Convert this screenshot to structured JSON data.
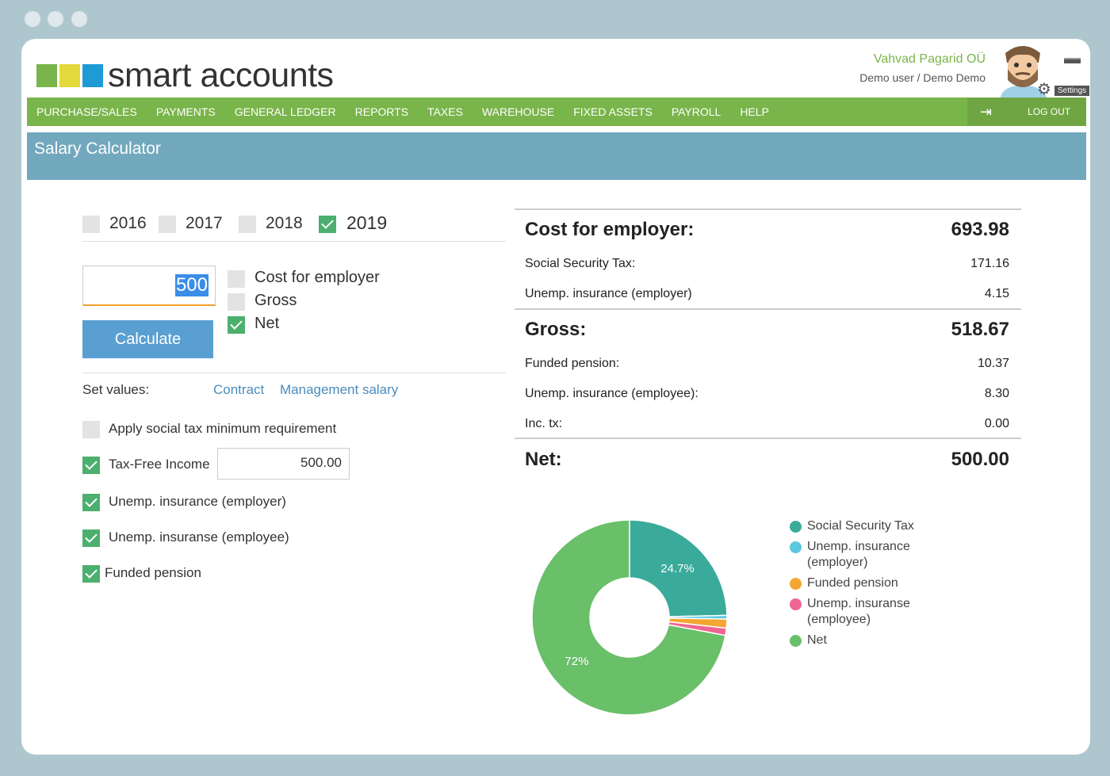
{
  "app": {
    "logo_text": "smart accounts",
    "logo_colors": [
      "#79b54a",
      "#e3d93a",
      "#1e9ad6"
    ],
    "company": "Vahvad Pagarid OÜ",
    "user": "Demo user / Demo Demo",
    "settings_label": "Settings"
  },
  "nav": {
    "items": [
      "PURCHASE/SALES",
      "PAYMENTS",
      "GENERAL LEDGER",
      "REPORTS",
      "TAXES",
      "WAREHOUSE",
      "FIXED ASSETS",
      "PAYROLL",
      "HELP"
    ],
    "logout": "LOG OUT"
  },
  "page": {
    "title": "Salary Calculator"
  },
  "years": [
    {
      "label": "2016",
      "checked": false
    },
    {
      "label": "2017",
      "checked": false
    },
    {
      "label": "2018",
      "checked": false
    },
    {
      "label": "2019",
      "checked": true
    }
  ],
  "calc": {
    "amount": "500",
    "button": "Calculate",
    "modes": [
      {
        "label": "Cost for employer",
        "checked": false
      },
      {
        "label": "Gross",
        "checked": false
      },
      {
        "label": "Net",
        "checked": true
      }
    ]
  },
  "set_values": {
    "label": "Set values:",
    "links": [
      "Contract",
      "Management salary"
    ]
  },
  "options": {
    "social_min": {
      "label": "Apply social tax minimum requirement",
      "checked": false
    },
    "tax_free": {
      "label": "Tax-Free Income",
      "checked": true,
      "value": "500.00"
    },
    "unemp_employer": {
      "label": "Unemp. insurance (employer)",
      "checked": true
    },
    "unemp_employee": {
      "label": "Unemp. insuranse (employee)",
      "checked": true
    },
    "funded_pension": {
      "label": "Funded pension",
      "checked": true
    }
  },
  "results": {
    "cost": {
      "label": "Cost for employer:",
      "value": "693.98"
    },
    "social_tax": {
      "label": "Social Security Tax:",
      "value": "171.16"
    },
    "unemp_employer": {
      "label": "Unemp. insurance (employer)",
      "value": "4.15"
    },
    "gross": {
      "label": "Gross:",
      "value": "518.67"
    },
    "funded_pension": {
      "label": "Funded pension:",
      "value": "10.37"
    },
    "unemp_employee": {
      "label": "Unemp. insurance (employee):",
      "value": "8.30"
    },
    "inc_tax": {
      "label": "Inc. tx:",
      "value": "0.00"
    },
    "net": {
      "label": "Net:",
      "value": "500.00"
    }
  },
  "chart_data": {
    "type": "pie",
    "categories": [
      "Social Security Tax",
      "Unemp. insurance (employer)",
      "Funded pension",
      "Unemp. insuranse (employee)",
      "Net"
    ],
    "values": [
      171.16,
      4.15,
      10.37,
      8.3,
      500.0
    ],
    "colors": [
      "#3aab9b",
      "#5bc8dd",
      "#f5a531",
      "#ee6592",
      "#6abf69"
    ],
    "data_labels": [
      "24.7%",
      "",
      "",
      "",
      "72%"
    ],
    "legend": "right"
  }
}
